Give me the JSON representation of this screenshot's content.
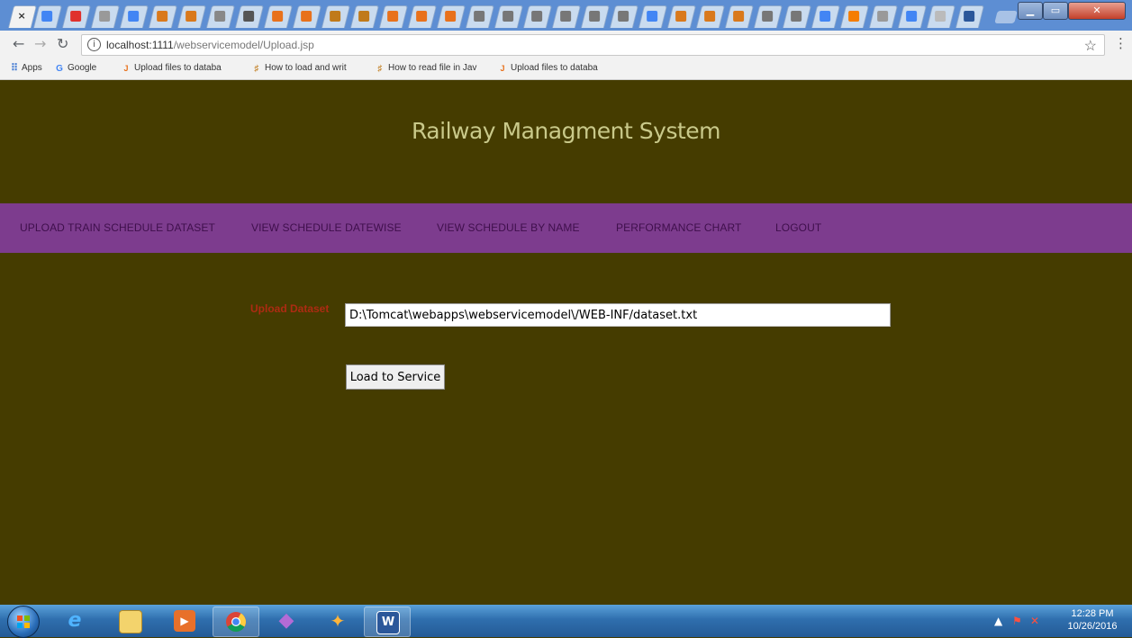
{
  "browser": {
    "url_host": "localhost:1111",
    "url_path": "/webservicemodel/Upload.jsp",
    "tab_close_glyph": "×",
    "bookmarks": [
      {
        "icon": "apps-icon",
        "label": "Apps"
      },
      {
        "icon": "google-icon",
        "label": "Google"
      },
      {
        "icon": "javatpoint-icon",
        "label": "Upload files to databa"
      },
      {
        "icon": "howto-icon",
        "label": "How to load and writ"
      },
      {
        "icon": "howto-icon",
        "label": "How to read file in Jav"
      },
      {
        "icon": "javatpoint-icon",
        "label": "Upload files to databa"
      }
    ]
  },
  "page": {
    "site_title": "Railway Managment System",
    "nav": [
      "UPLOAD TRAIN SCHEDULE DATASET",
      "VIEW SCHEDULE DATEWISE",
      "VIEW SCHEDULE BY NAME",
      "PERFORMANCE CHART",
      "LOGOUT"
    ],
    "upload_label": "Upload Dataset",
    "dataset_path": "D:\\Tomcat\\webapps\\webservicemodel\\/WEB-INF/dataset.txt",
    "load_button": "Load to Service"
  },
  "taskbar": {
    "time": "12:28 PM",
    "date": "10/26/2016"
  },
  "colors": {
    "page_background": "#453c00",
    "navbar_background": "#7d3c8e",
    "navbar_link": "#3f0f4c",
    "site_title": "#c9c98a",
    "upload_label": "#ad2b12"
  }
}
